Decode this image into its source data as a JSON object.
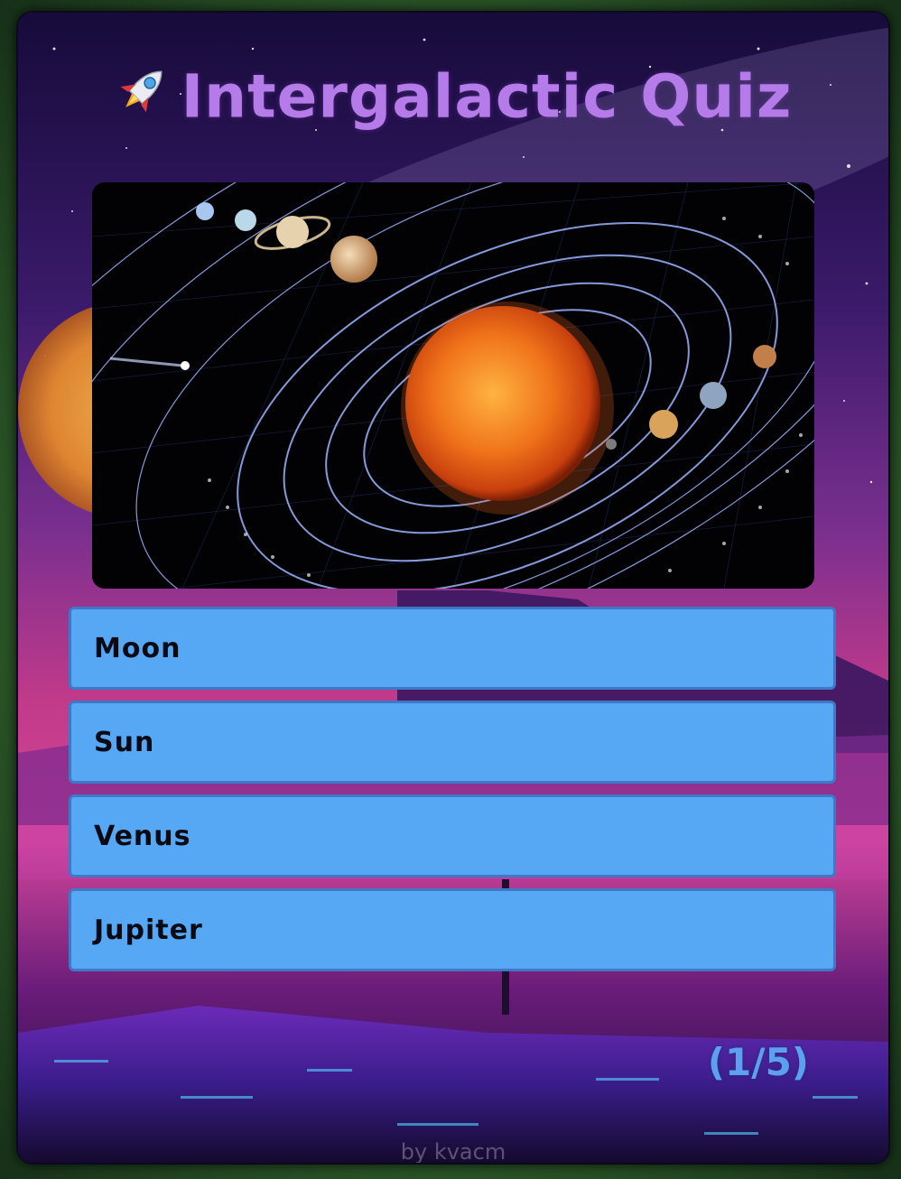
{
  "header": {
    "icon": "rocket-icon",
    "title": "Intergalactic Quiz"
  },
  "question": {
    "image": "solar-system-illustration"
  },
  "answers": [
    {
      "label": "Moon"
    },
    {
      "label": "Sun"
    },
    {
      "label": "Venus"
    },
    {
      "label": "Jupiter"
    }
  ],
  "progress": {
    "text": "(1/5)",
    "current": 1,
    "total": 5
  },
  "footer": {
    "credit": "by kvacm"
  },
  "colors": {
    "title": "#b57be8",
    "answer_bg": "#56a8f5",
    "answer_border": "#3f78c7",
    "progress": "#5d9ff0",
    "frame": "#2f5e2a"
  }
}
